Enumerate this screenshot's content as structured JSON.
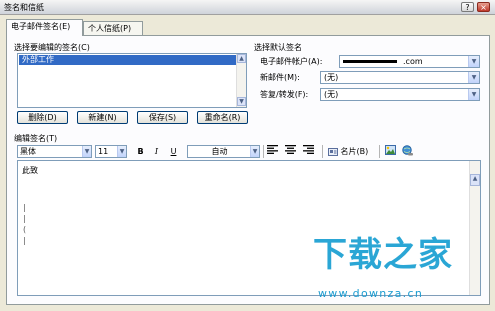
{
  "window": {
    "title": "签名和信纸",
    "controls": {
      "help": "?",
      "close": "×"
    }
  },
  "tabs": [
    {
      "label": "电子邮件签名(E)",
      "active": true
    },
    {
      "label": "个人信纸(P)",
      "active": false
    }
  ],
  "signatures": {
    "group_label": "选择要编辑的签名(C)",
    "items": [
      "外部工作"
    ],
    "selected_index": 0,
    "buttons": {
      "delete": "删除(D)",
      "new": "新建(N)",
      "save": "保存(S)",
      "rename": "重命名(R)"
    }
  },
  "default_signature": {
    "group_label": "选择默认签名",
    "account_label": "电子邮件帐户(A):",
    "account_value_visible": ".com",
    "new_messages_label": "新邮件(M):",
    "new_messages_value": "(无)",
    "replies_label": "答复/转发(F):",
    "replies_value": "(无)"
  },
  "editor": {
    "label": "编辑签名(T)",
    "toolbar": {
      "font_value": "黑体",
      "size_value": "11",
      "bold": "B",
      "italic": "I",
      "underline": "U",
      "color_value": "自动",
      "business_card_label": "名片(B)"
    },
    "content_first_line": "此致",
    "content_marks": [
      "|",
      "|",
      "(",
      "|"
    ]
  },
  "watermark": {
    "title": "下载之家",
    "url": "www.downza.cn"
  },
  "colors": {
    "dialog_bg": "#ece9d8",
    "selection": "#316ac5",
    "watermark": "#2aa6d5"
  }
}
